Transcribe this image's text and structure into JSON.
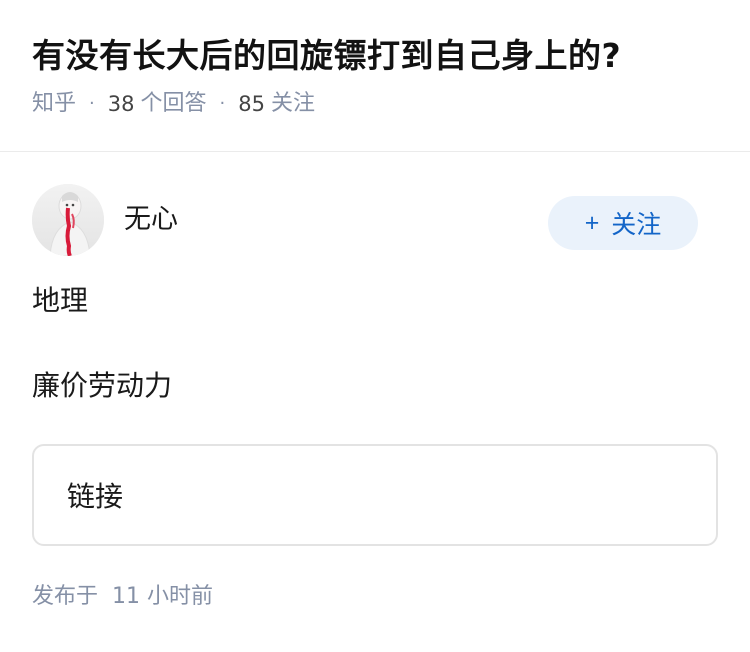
{
  "question": {
    "title": "有没有长大后的回旋镖打到自己身上的?",
    "source": "知乎",
    "answers_count": "38",
    "answers_label": "个回答",
    "followers_count": "85",
    "followers_label": "关注"
  },
  "answer": {
    "author": {
      "name": "无心",
      "avatar": "avatar-image"
    },
    "follow_button": {
      "icon": "plus-icon",
      "label": "关注"
    },
    "content_lines": [
      "地理",
      "廉价劳动力"
    ],
    "link_card_label": "链接",
    "published_prefix": "发布于",
    "published_time": "11 小时前"
  },
  "colors": {
    "title": "#121212",
    "meta": "#8590a6",
    "accent": "#1365c8",
    "follow_bg": "#eaf2fb",
    "divider": "#ebebeb",
    "card_border": "#e3e3e3"
  }
}
